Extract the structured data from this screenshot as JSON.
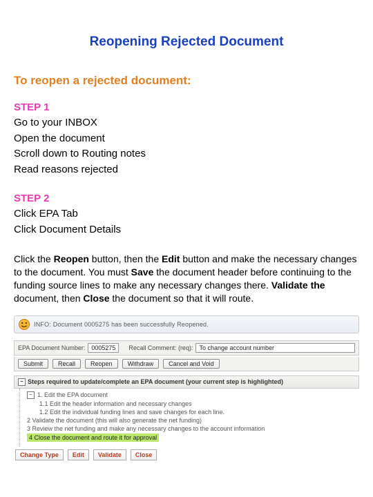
{
  "title": "Reopening Rejected Document",
  "subtitle": "To reopen a rejected document:",
  "step1": {
    "label": "STEP 1",
    "l1": "Go to your INBOX",
    "l2": "Open the document",
    "l3": "Scroll down to Routing notes",
    "l4": "Read reasons rejected"
  },
  "step2": {
    "label": "STEP 2",
    "l1": "Click EPA Tab",
    "l2": "Click Document Details"
  },
  "para": {
    "t1": "Click the ",
    "b1": "Reopen",
    "t2": " button, then the ",
    "b2": "Edit",
    "t3": " button and make the necessary changes to the document.  You must ",
    "b3": "Save",
    "t4": " the document header before continuing to the funding source lines to make any necessary changes there. ",
    "b4": "Validate the",
    "t5": " document, then ",
    "b5": "Close",
    "t6": " the document so that it will route."
  },
  "shot": {
    "info": "INFO: Document 0005275 has been successfully Reopened.",
    "docnum_label": "EPA Document Number:",
    "docnum_value": "0005275",
    "recall_label": "Recall Comment: (req):",
    "recall_value": "To change account number",
    "btn_submit": "Submit",
    "btn_recall": "Recall",
    "btn_reopen": "Reopen",
    "btn_withdraw": "Withdraw",
    "btn_cancelvoid": "Cancel and Void",
    "steps_header": "Steps required to update/complete an EPA document (your current step is highlighted)",
    "s1": "1. Edit the EPA document",
    "s11": "1.1 Edit the header information and necessary changes",
    "s12": "1.2 Edit the individual funding lines and save changes for each line.",
    "s2": "2 Validate the document (this will also generate the net funding)",
    "s3": "3 Review the net funding and make any necessary changes to the account information",
    "s4": "4 Close the document and route it for approval",
    "bb_change": "Change Type",
    "bb_edit": "Edit",
    "bb_validate": "Validate",
    "bb_close": "Close"
  }
}
